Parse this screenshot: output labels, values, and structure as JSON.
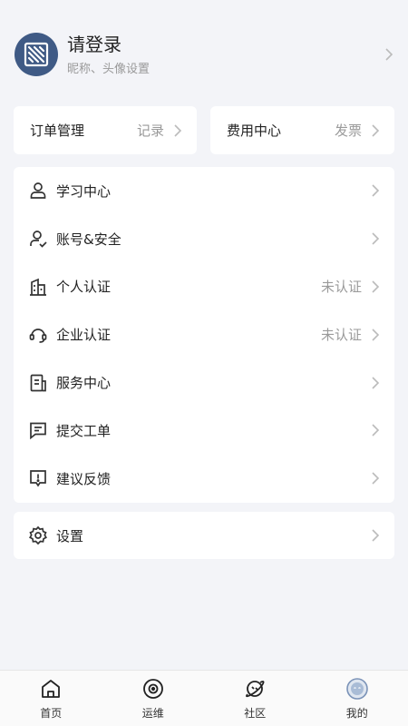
{
  "profile": {
    "title": "请登录",
    "subtitle": "昵称、头像设置",
    "avatar_icon": "logo-avatar-icon"
  },
  "quick_cards": [
    {
      "label": "订单管理",
      "sub": "记录"
    },
    {
      "label": "费用中心",
      "sub": "发票"
    }
  ],
  "menu": [
    {
      "label": "学习中心",
      "sub": "",
      "icon": "user-icon"
    },
    {
      "label": "账号&安全",
      "sub": "",
      "icon": "user-check-icon"
    },
    {
      "label": "个人认证",
      "sub": "未认证",
      "icon": "building-icon"
    },
    {
      "label": "企业认证",
      "sub": "未认证",
      "icon": "headset-icon"
    },
    {
      "label": "服务中心",
      "sub": "",
      "icon": "document-icon"
    },
    {
      "label": "提交工单",
      "sub": "",
      "icon": "message-icon"
    },
    {
      "label": "建议反馈",
      "sub": "",
      "icon": "feedback-icon"
    }
  ],
  "settings": {
    "label": "设置",
    "icon": "gear-icon"
  },
  "tabbar": [
    {
      "label": "首页",
      "icon": "home-icon"
    },
    {
      "label": "运维",
      "icon": "target-icon"
    },
    {
      "label": "社区",
      "icon": "planet-icon"
    },
    {
      "label": "我的",
      "icon": "profile-face-icon",
      "active": true
    }
  ],
  "colors": {
    "accent": "#3f5a85",
    "active_tab": "#6e8bb3"
  }
}
